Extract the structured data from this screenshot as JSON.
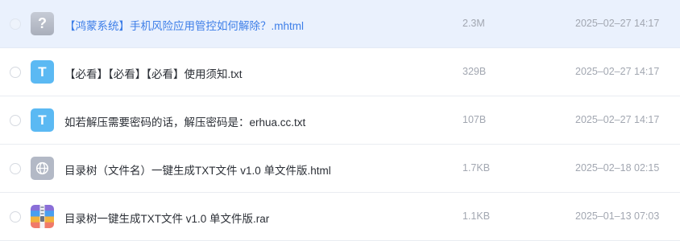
{
  "files": [
    {
      "name": "【鸿蒙系统】手机风险应用管控如何解除？.mhtml",
      "size": "2.3M",
      "date": "2025–02–27 14:17",
      "icon": "unknown-file-icon",
      "icon_glyph": "?",
      "selected_hover": true
    },
    {
      "name": "【必看】【必看】【必看】使用须知.txt",
      "size": "329B",
      "date": "2025–02–27 14:17",
      "icon": "txt-file-icon",
      "icon_glyph": "T"
    },
    {
      "name": "如若解压需要密码的话，解压密码是：erhua.cc.txt",
      "size": "107B",
      "date": "2025–02–27 14:17",
      "icon": "txt-file-icon",
      "icon_glyph": "T"
    },
    {
      "name": "目录树（文件名）一键生成TXT文件 v1.0 单文件版.html",
      "size": "1.7KB",
      "date": "2025–02–18 02:15",
      "icon": "web-file-icon"
    },
    {
      "name": "目录树一键生成TXT文件 v1.0 单文件版.rar",
      "size": "1.1KB",
      "date": "2025–01–13 07:03",
      "icon": "archive-file-icon"
    }
  ],
  "colors": {
    "hover_row_bg": "#eaf1fd",
    "hover_text": "#3d7ee8",
    "txt_icon": "#5bb9f3"
  }
}
